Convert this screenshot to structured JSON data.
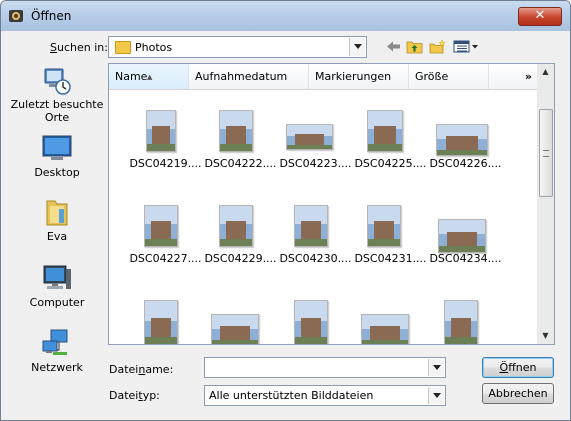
{
  "window": {
    "title": "Öffnen",
    "close_glyph": "✕"
  },
  "toolbar": {
    "lookin_label_prefix": "S",
    "lookin_label_rest": "uchen in:",
    "lookin_value": "Photos",
    "icons": [
      "back-arrow-icon",
      "up-folder-icon",
      "new-folder-icon",
      "views-menu-icon"
    ]
  },
  "places": [
    {
      "label": "Zuletzt besuchte Orte",
      "icon": "recent-places-icon"
    },
    {
      "label": "Desktop",
      "icon": "desktop-icon"
    },
    {
      "label": "Eva",
      "icon": "user-folder-icon"
    },
    {
      "label": "Computer",
      "icon": "computer-icon"
    },
    {
      "label": "Netzwerk",
      "icon": "network-icon"
    }
  ],
  "columns": [
    "Name",
    "Aufnahmedatum",
    "Markierungen",
    "Größe",
    "»"
  ],
  "files": [
    {
      "name": "DSC04219...."
    },
    {
      "name": "DSC04222...."
    },
    {
      "name": "DSC04223...."
    },
    {
      "name": "DSC04225...."
    },
    {
      "name": "DSC04226...."
    },
    {
      "name": "DSC04227...."
    },
    {
      "name": "DSC04229...."
    },
    {
      "name": "DSC04230...."
    },
    {
      "name": "DSC04231...."
    },
    {
      "name": "DSC04234...."
    },
    {
      "name": ""
    },
    {
      "name": ""
    },
    {
      "name": ""
    },
    {
      "name": ""
    },
    {
      "name": ""
    }
  ],
  "filename": {
    "label_pre": "Datei",
    "label_u": "n",
    "label_post": "ame:",
    "value": ""
  },
  "filetype": {
    "label_pre": "Datei",
    "label_u": "t",
    "label_post": "yp:",
    "value": "Alle unterstützten Bilddateien"
  },
  "buttons": {
    "open_u": "Ö",
    "open_rest": "ffnen",
    "cancel": "Abbrechen"
  }
}
